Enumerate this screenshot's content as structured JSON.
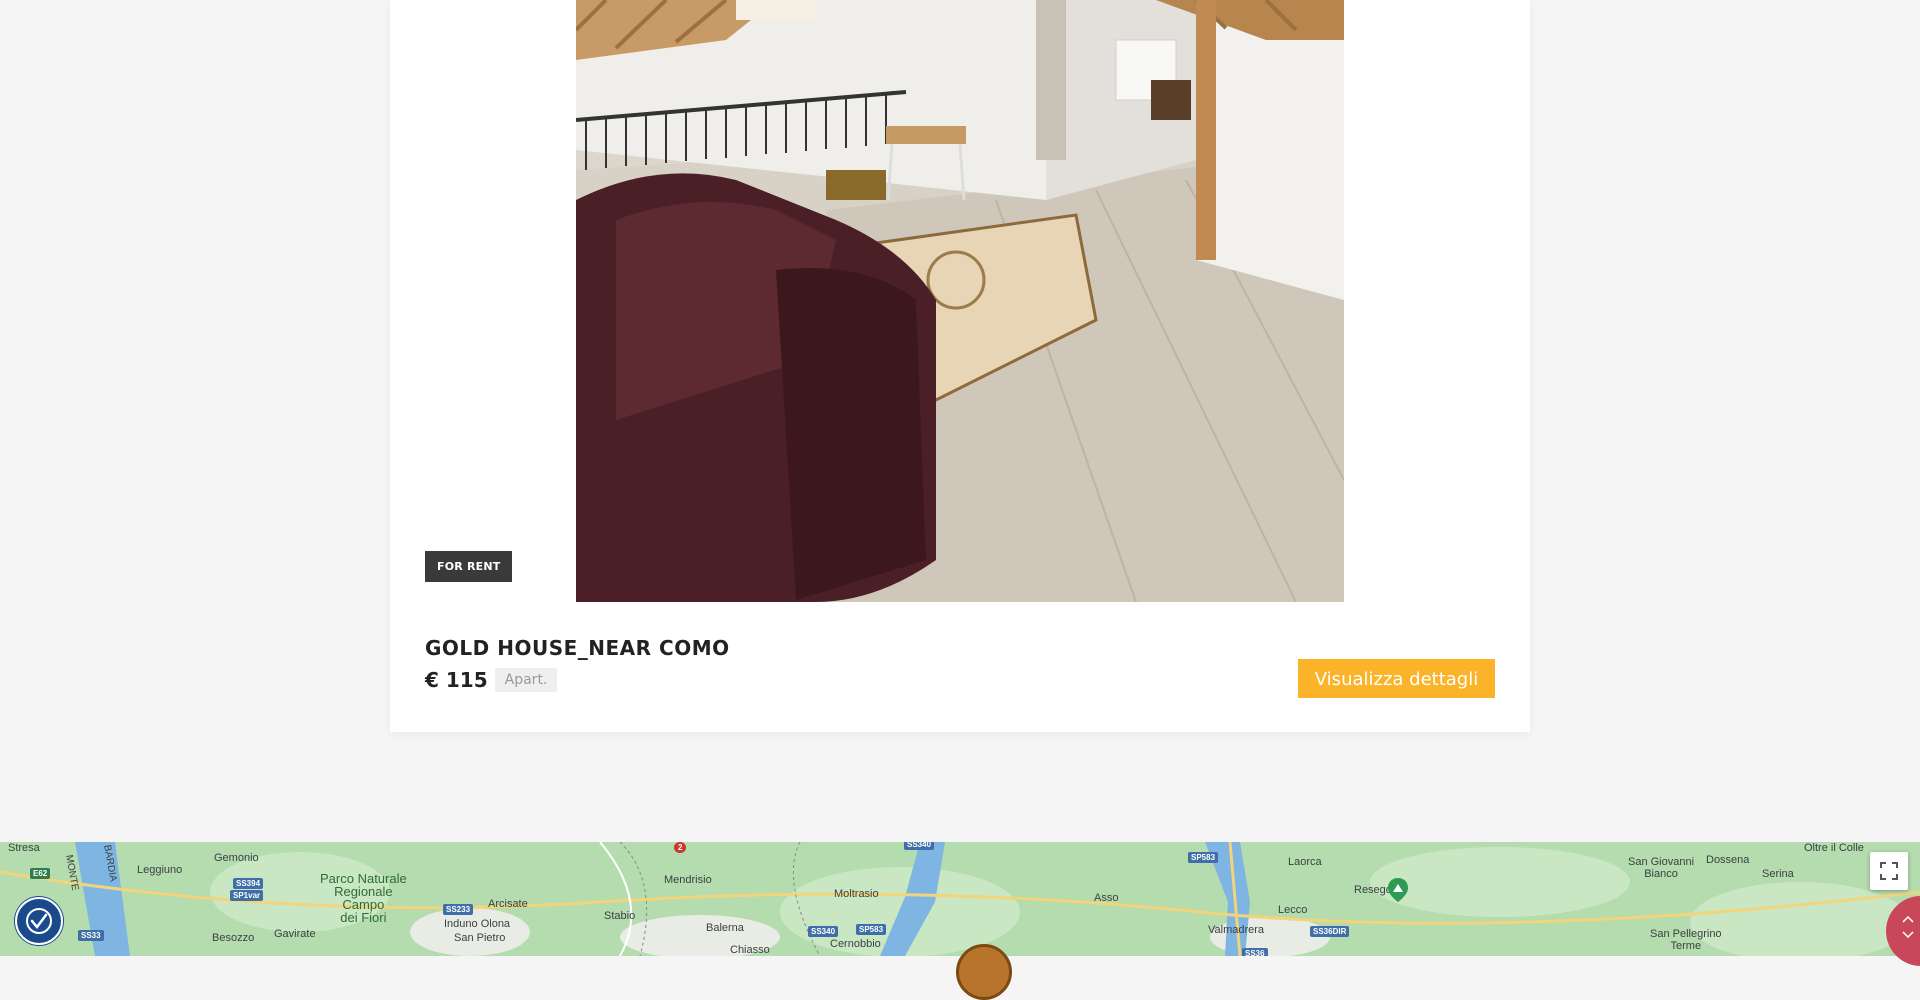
{
  "listing": {
    "badge": "FOR RENT",
    "title": "GOLD HOUSE_NEAR COMO",
    "price": "€ 115",
    "type": "Apart.",
    "details_button": "Visualizza dettagli"
  },
  "map": {
    "labels": {
      "stresa": "Stresa",
      "gemonio": "Gemonio",
      "leggiuno": "Leggiuno",
      "parco": "Parco Naturale\nRegionale\nCampo\ndei Fiori",
      "besozzo": "Besozzo",
      "gavirate": "Gavirate",
      "arcisate": "Arcisate",
      "induno": "Induno Olona",
      "san_pietro": "San Pietro",
      "stabio": "Stabio",
      "mendrisio": "Mendrisio",
      "balerna": "Balerna",
      "chiasso": "Chiasso",
      "moltrasio": "Moltrasio",
      "cernobbio": "Cernobbio",
      "asso": "Asso",
      "laorca": "Laorca",
      "resegone": "Resegone",
      "lecco": "Lecco",
      "valmadrera": "Valmadrera",
      "san_giovanni_bianco": "San Giovanni\nBianco",
      "dossena": "Dossena",
      "serina": "Serina",
      "san_pellegrino": "San Pellegrino\nTerme",
      "oltre_il_colle": "Oltre il Colle",
      "monte": "MONTE",
      "lombardia": "BARDIA"
    },
    "shields": [
      "E62",
      "SS394",
      "SP1var",
      "SS233",
      "SS33",
      "2",
      "SS340",
      "SP583",
      "SS340",
      "SP583",
      "SS36DIR",
      "SS36"
    ]
  },
  "colors": {
    "accent": "#fbb429",
    "badge_bg": "#3a3a3a",
    "map_bg": "#aadaad"
  }
}
